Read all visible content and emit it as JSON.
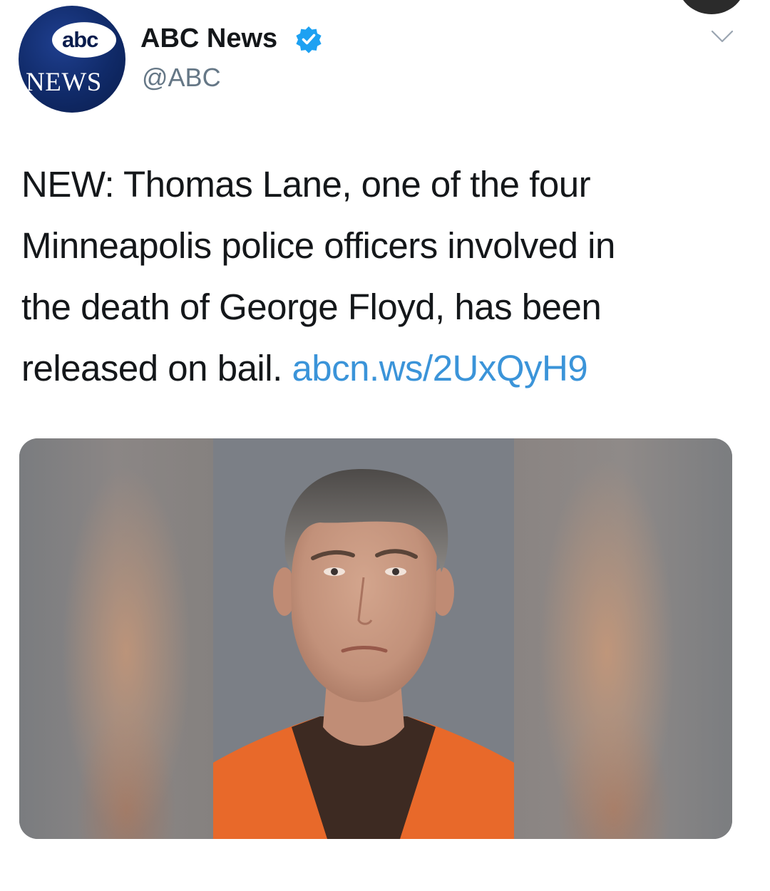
{
  "account": {
    "avatar_logo_top": "abc",
    "avatar_logo_bottom": "NEWS",
    "display_name": "ABC News",
    "handle": "@ABC",
    "verified": true
  },
  "icons": {
    "verified": "verified-badge-icon",
    "more": "chevron-down-icon"
  },
  "tweet": {
    "lines": [
      "NEW: Thomas Lane, one of the four",
      "Minneapolis police officers involved in",
      "the death of George Floyd, has been",
      "released on bail. "
    ],
    "link": "abcn.ws/2UxQyH9"
  },
  "colors": {
    "link": "#3b94d9",
    "verified_badge": "#1da1f2",
    "handle": "#657786",
    "jumpsuit": "#e8692a"
  }
}
